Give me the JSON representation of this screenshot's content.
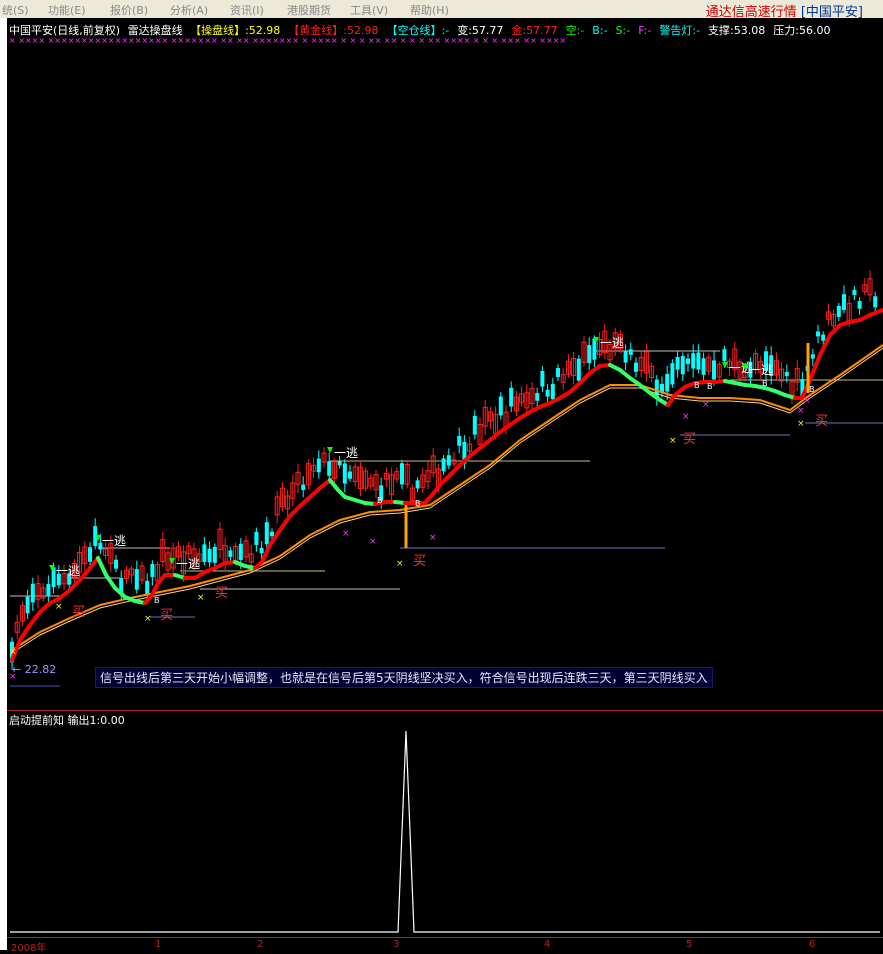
{
  "menu": {
    "items": [
      "统(S)",
      "功能(E)",
      "报价(B)",
      "分析(A)",
      "资讯(I)",
      "港股期货",
      "工具(V)",
      "帮助(H)"
    ]
  },
  "app": {
    "title": "通达信高速行情",
    "code": "[中国平安]"
  },
  "header": {
    "stock": "中国平安(日线,前复权)",
    "indicator": "雷达操盘线",
    "items": [
      {
        "label": "【操盘线】",
        "value": ":52.98",
        "label_color": "#ffff00",
        "value_color": "#ffff00"
      },
      {
        "label": "【黄金线】",
        "value": ":52.98",
        "label_color": "#ff2020",
        "value_color": "#ff2020"
      },
      {
        "label": "【空仓线】",
        "value": ":-",
        "label_color": "#00ffff",
        "value_color": "#00ffff"
      },
      {
        "label": "变",
        "value": ":57.77",
        "label_color": "#ffffff",
        "value_color": "#ffffff"
      },
      {
        "label": "金",
        "value": ":57.77",
        "label_color": "#ff2020",
        "value_color": "#ff2020"
      },
      {
        "label": "空",
        "value": ":-",
        "label_color": "#00ff00",
        "value_color": "#00ff00"
      },
      {
        "label": "B",
        "value": ":-",
        "label_color": "#00ffff",
        "value_color": "#00ffff"
      },
      {
        "label": "S",
        "value": ":-",
        "label_color": "#00ff00",
        "value_color": "#00ff00"
      },
      {
        "label": "F",
        "value": ":-",
        "label_color": "#ff33ff",
        "value_color": "#ff33ff"
      },
      {
        "label": "警告灯",
        "value": ":-",
        "label_color": "#00ffff",
        "value_color": "#00ffff"
      },
      {
        "label": "支撑",
        "value": ":53.08",
        "label_color": "#ffffff",
        "value_color": "#ffffff"
      },
      {
        "label": "压力",
        "value": ":56.00",
        "label_color": "#ffffff",
        "value_color": "#ffffff"
      }
    ],
    "x_markers": "×  ××××   ×××××××××××××××××× ××××××× ××  ××      ×××××××   ×  ××××   × × × ×× ××  × ×  × ×× ××××  × × × ××× ×× ××××"
  },
  "chart_data": {
    "type": "candlestick",
    "title": "",
    "price_low_label": "22.82",
    "annotation": "信号出线后第三天开始小幅调整，也就是在信号后第5天阴线坚决买入，符合信号出现后连跌三天，第三天阴线买入",
    "escape_label": "一逃",
    "buy_label": "买",
    "b_marker": "B",
    "signal_panel": {
      "label": "启动提前知  输出1:0.00",
      "spike_at_month": 3,
      "spike_value": 1
    },
    "x_tick_labels": [
      "2008年",
      "1",
      "2",
      "3",
      "4",
      "5",
      "6"
    ],
    "colors": {
      "up": "#ff2020",
      "down": "#00ffff",
      "rising_line": "#ff0000",
      "falling_line": "#33ff66",
      "support_line": "#ff8c00"
    }
  }
}
